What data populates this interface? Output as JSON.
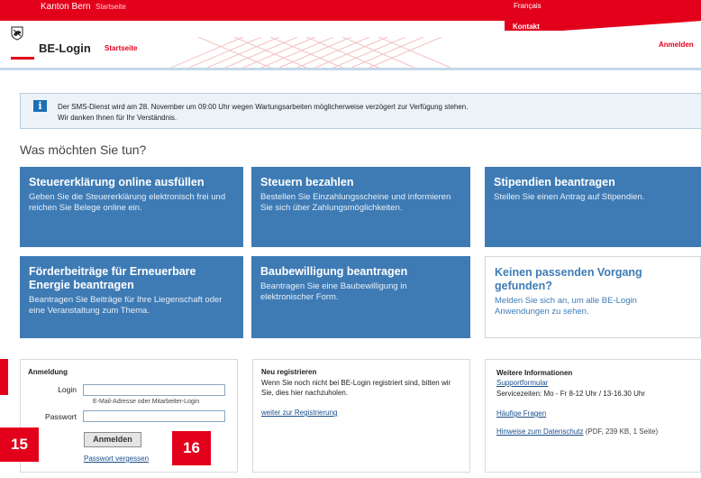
{
  "topbar": {
    "canton": "Kanton Bern",
    "startseite": "Startseite",
    "language": "Français",
    "kontakt": "Kontakt"
  },
  "header": {
    "brand": "BE-Login",
    "startseite": "Startseite",
    "login_link": "Anmelden"
  },
  "info": {
    "icon": "info-icon",
    "line1": "Der SMS-Dienst wird am 28. November um 09:00 Uhr wegen Wartungsarbeiten möglicherweise verzögert zur Verfügung stehen.",
    "line2": "Wir danken Ihnen für Ihr Verständnis."
  },
  "question": "Was möchten Sie tun?",
  "tiles": [
    {
      "title": "Steuererklärung online ausfüllen",
      "desc": "Geben Sie die Steuererklärung elektronisch frei und reichen Sie Belege online ein."
    },
    {
      "title": "Steuern bezahlen",
      "desc": "Bestellen Sie Einzahlungsscheine und informieren Sie sich über Zahlungsmöglichkeiten."
    },
    {
      "title": "Stipendien beantragen",
      "desc": "Stellen Sie einen Antrag auf Stipendien."
    },
    {
      "title": "Förderbeiträge für Erneuerbare Energie beantragen",
      "desc": "Beantragen Sie Beiträge für Ihre Liegenschaft oder eine Veranstaltung zum Thema."
    },
    {
      "title": "Baubewilligung beantragen",
      "desc": "Beantragen Sie eine Baubewilligung in elektronischer Form."
    },
    {
      "title": "Keinen passenden Vorgang gefunden?",
      "desc": "Melden Sie sich an, um alle BE-Login Anwendungen zu sehen."
    }
  ],
  "login": {
    "title": "Anmeldung",
    "login_label": "Login",
    "login_value": "",
    "login_hint": "E-Mail-Adresse oder Mitarbeiter-Login",
    "password_label": "Passwort",
    "password_value": "",
    "submit": "Anmelden",
    "forgot": "Passwort vergessen"
  },
  "register": {
    "title": "Neu registrieren",
    "text": "Wenn Sie noch nicht bei BE-Login registriert sind, bitten wir Sie, dies hier nachzuholen.",
    "link": "weiter zur Registrierung"
  },
  "more_info": {
    "title": "Weitere Informationen",
    "support_link": "Supportformular",
    "hours": "Servicezeiten: Mo - Fr 8-12 Uhr / 13-16.30 Uhr",
    "faq_link": "Häufige Fragen",
    "privacy_link": "Hinweise zum Datenschutz",
    "privacy_meta": "(PDF, 239 KB, 1 Seite)"
  },
  "badges": [
    "15",
    "16"
  ],
  "colors": {
    "brand_red": "#e3001b",
    "tile_blue": "#3e7bb5",
    "link_blue": "#1a4f8a"
  }
}
